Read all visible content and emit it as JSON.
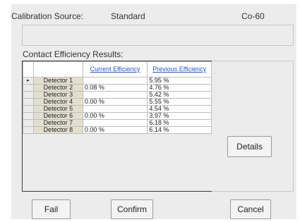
{
  "header": {
    "source_label": "Calibration Source:",
    "source_value": "Standard",
    "isotope": "Co-60"
  },
  "results": {
    "label": "Contact Efficiency Results:",
    "columns": [
      "Current Efficiency",
      "Previous Efficiency"
    ],
    "selected_row": 0,
    "selector_glyph": "▸",
    "rows": [
      {
        "detector": "Detector 1",
        "current": "",
        "previous": "5.95 %"
      },
      {
        "detector": "Detector 2",
        "current": "0.08 %",
        "previous": "4.76 %"
      },
      {
        "detector": "Detector 3",
        "current": "",
        "previous": "5.42 %"
      },
      {
        "detector": "Detector 4",
        "current": "0.00 %",
        "previous": "5.55 %"
      },
      {
        "detector": "Detector 5",
        "current": "",
        "previous": "4.54 %"
      },
      {
        "detector": "Detector 6",
        "current": "0.00 %",
        "previous": "3.97 %"
      },
      {
        "detector": "Detector 7",
        "current": "",
        "previous": "6.18 %"
      },
      {
        "detector": "Detector 8",
        "current": "0.00 %",
        "previous": "6.14 %"
      }
    ]
  },
  "buttons": {
    "details": "Details",
    "fail": "Fail",
    "confirm": "Confirm",
    "cancel": "Cancel"
  },
  "colors": {
    "link": "#2a55c4",
    "detector_cell": "#e3dfcf",
    "panel": "#ececec"
  }
}
